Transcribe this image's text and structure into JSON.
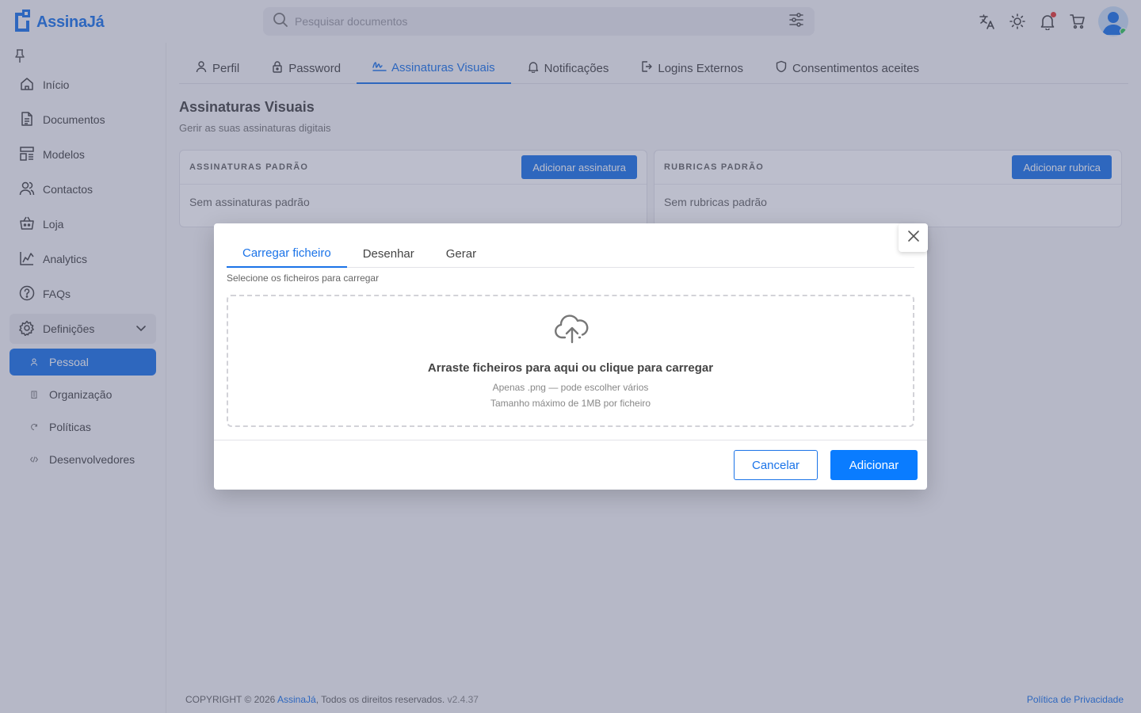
{
  "app": {
    "name": "AssinaJá"
  },
  "search": {
    "placeholder": "Pesquisar documentos"
  },
  "sidebar": {
    "items": [
      {
        "label": "Início",
        "icon": "home-icon"
      },
      {
        "label": "Documentos",
        "icon": "document-icon"
      },
      {
        "label": "Modelos",
        "icon": "template-icon"
      },
      {
        "label": "Contactos",
        "icon": "contacts-icon"
      },
      {
        "label": "Loja",
        "icon": "store-icon"
      },
      {
        "label": "Analytics",
        "icon": "analytics-icon"
      },
      {
        "label": "FAQs",
        "icon": "help-icon"
      },
      {
        "label": "Definições",
        "icon": "gear-icon",
        "expanded": true
      }
    ],
    "subitems": [
      {
        "label": "Pessoal",
        "icon": "user-icon",
        "active": true
      },
      {
        "label": "Organização",
        "icon": "building-icon"
      },
      {
        "label": "Políticas",
        "icon": "policy-icon"
      },
      {
        "label": "Desenvolvedores",
        "icon": "code-icon"
      }
    ]
  },
  "tabs": [
    {
      "label": "Perfil",
      "icon": "user-icon"
    },
    {
      "label": "Password",
      "icon": "lock-icon"
    },
    {
      "label": "Assinaturas Visuais",
      "icon": "signature-icon",
      "active": true
    },
    {
      "label": "Notificações",
      "icon": "bell-icon"
    },
    {
      "label": "Logins Externos",
      "icon": "login-icon"
    },
    {
      "label": "Consentimentos aceites",
      "icon": "shield-icon"
    }
  ],
  "page": {
    "title": "Assinaturas Visuais",
    "subtitle": "Gerir as suas assinaturas digitais"
  },
  "cards": {
    "signatures": {
      "title": "ASSINATURAS PADRÃO",
      "button": "Adicionar assinatura",
      "empty": "Sem assinaturas padrão"
    },
    "initials": {
      "title": "RUBRICAS PADRÃO",
      "button": "Adicionar rubrica",
      "empty": "Sem rubricas padrão"
    }
  },
  "modal": {
    "tabs": [
      "Carregar ficheiro",
      "Desenhar",
      "Gerar"
    ],
    "active_tab": "Carregar ficheiro",
    "hint": "Selecione os ficheiros para carregar",
    "dropzone": {
      "title": "Arraste ficheiros para aqui ou clique para carregar",
      "line1": "Apenas .png — pode escolher vários",
      "line2": "Tamanho máximo de 1MB por ficheiro"
    },
    "cancel": "Cancelar",
    "add": "Adicionar"
  },
  "footer": {
    "prefix": "COPYRIGHT © 2026",
    "brand": "AssinaJá",
    "rights": ", Todos os direitos reservados.",
    "version": "v2.4.37",
    "privacy": "Política de Privacidade"
  },
  "colors": {
    "accent": "#1a73e8",
    "primary_button": "#0a7cff",
    "notification": "#e53935",
    "online": "#34c759"
  }
}
